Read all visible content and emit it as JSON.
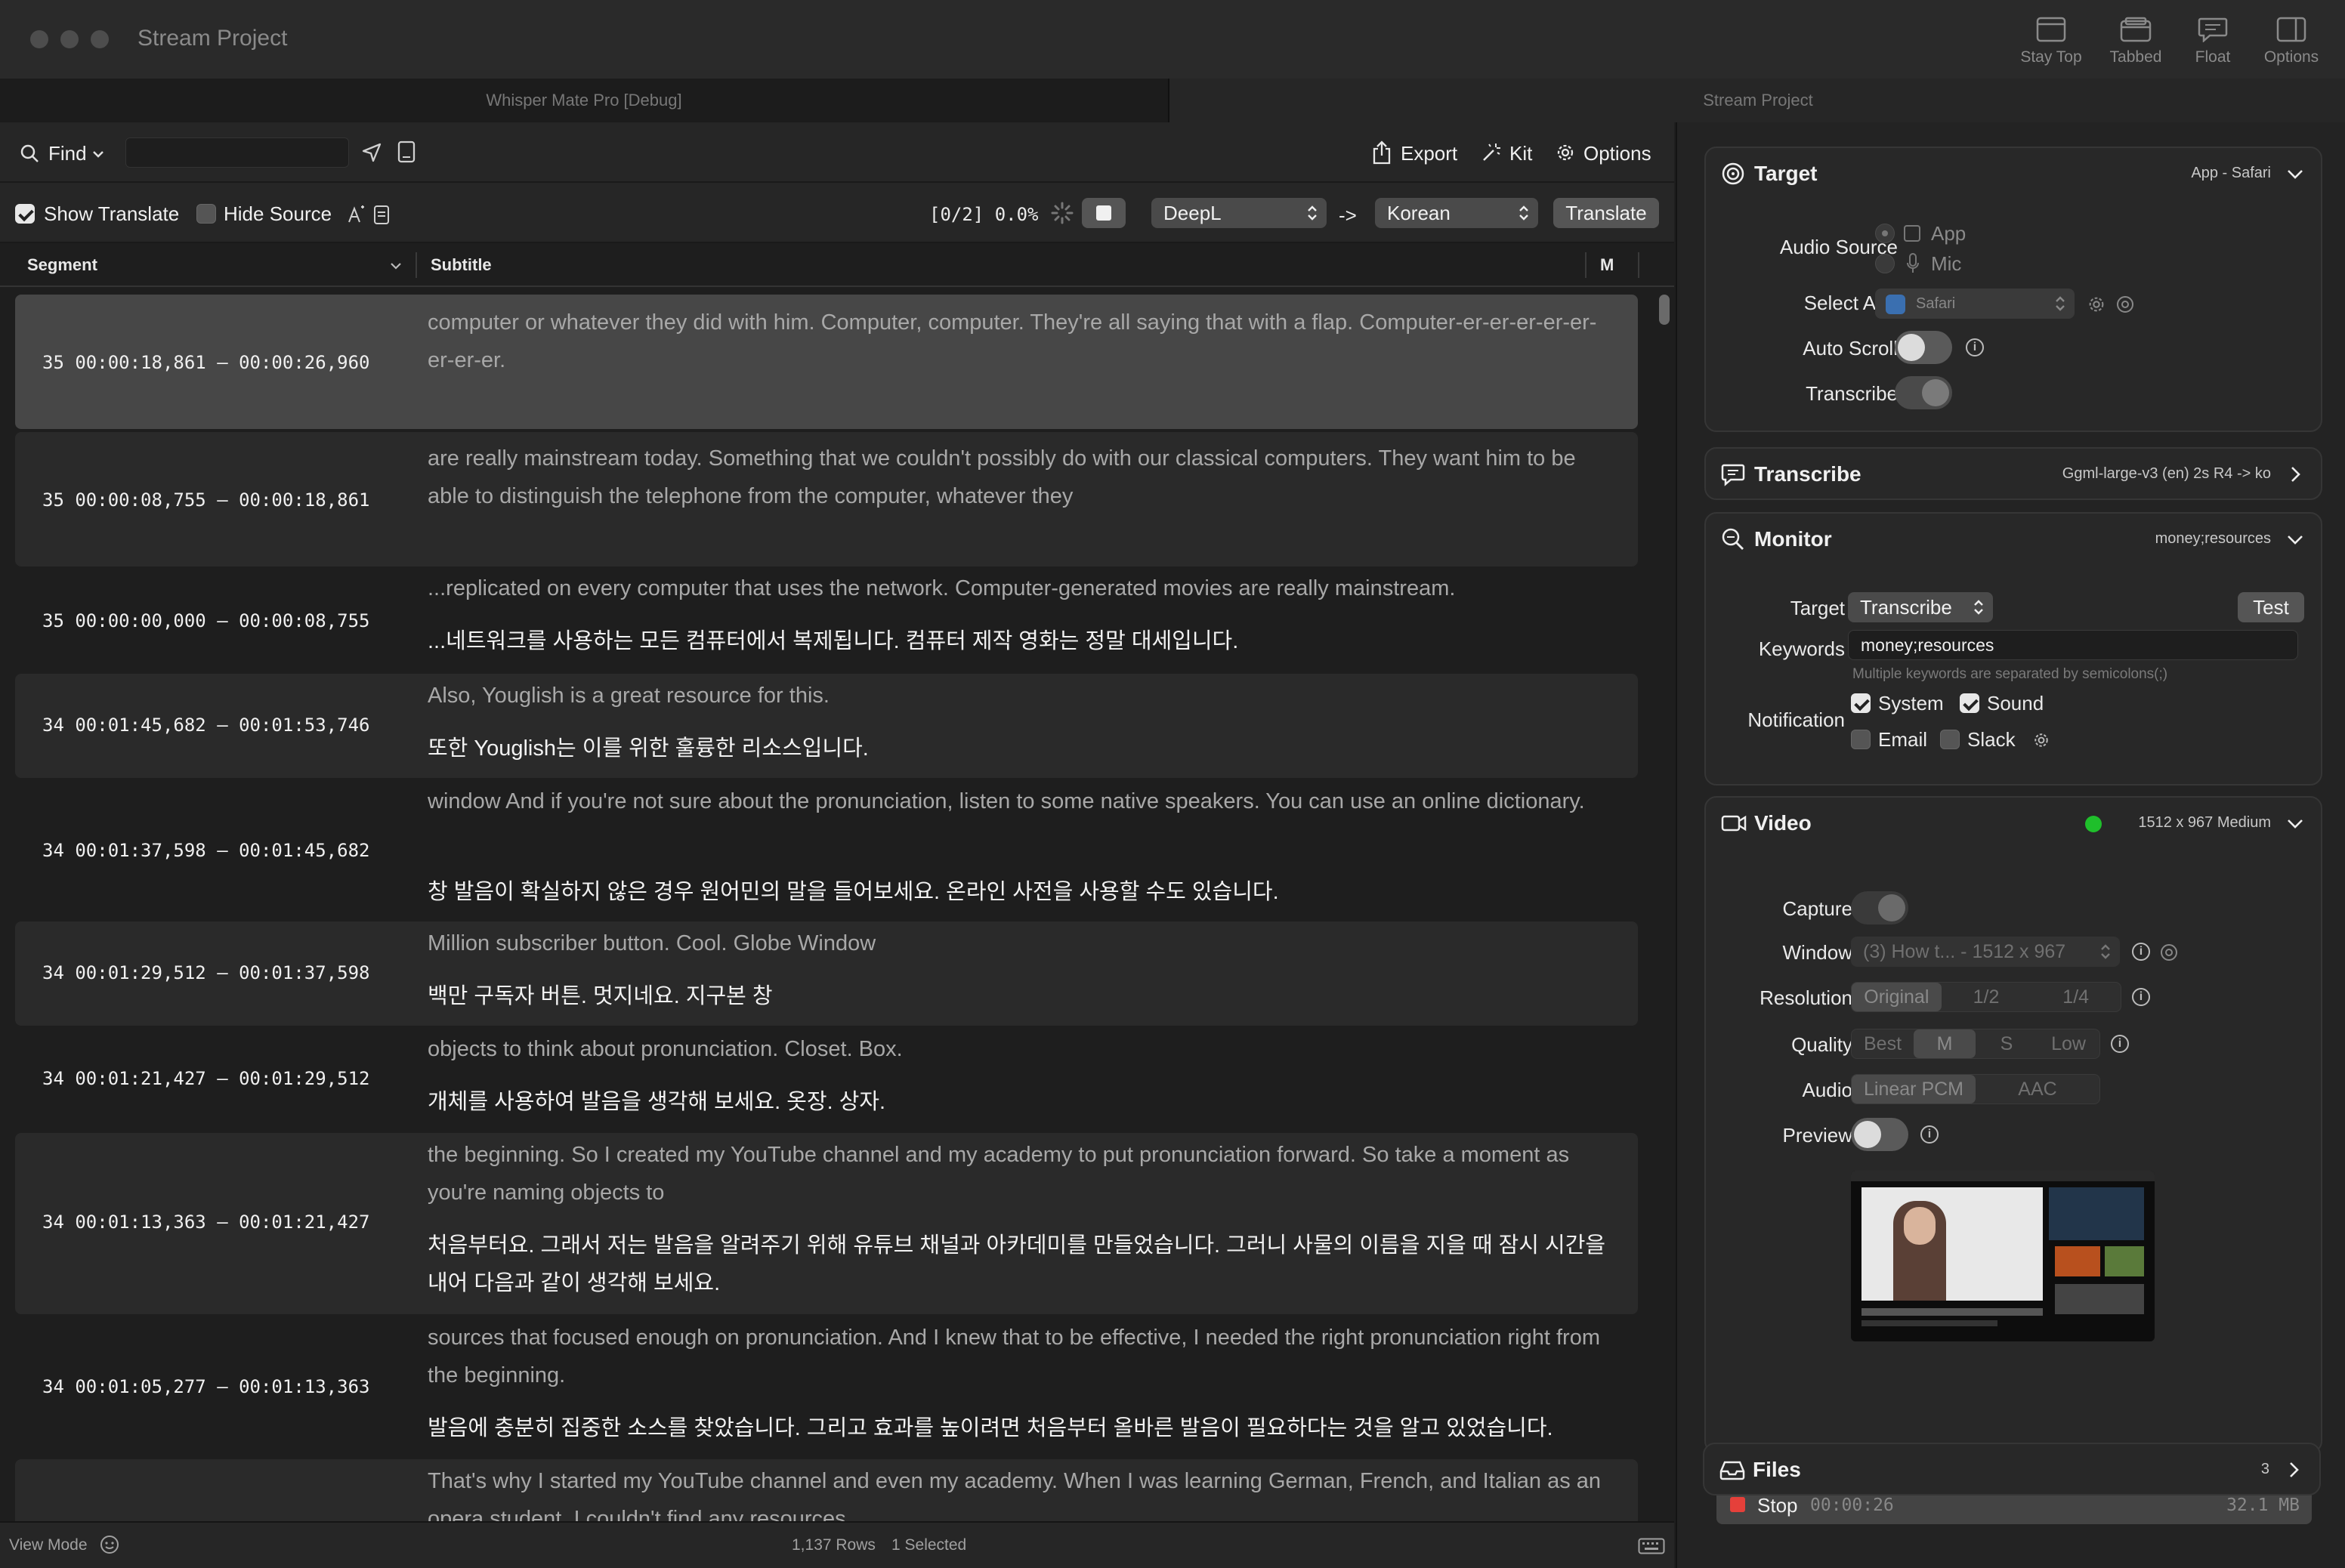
{
  "window": {
    "title": "Stream Project",
    "buttons": [
      {
        "label": "Stay Top",
        "icon": "window-icon"
      },
      {
        "label": "Tabbed",
        "icon": "tabbed-window-icon"
      },
      {
        "label": "Float",
        "icon": "speech-bubble-icon"
      },
      {
        "label": "Options",
        "icon": "sidebar-icon"
      }
    ]
  },
  "tabs": [
    "Whisper Mate Pro [Debug]",
    "Stream Project"
  ],
  "toolbar": {
    "find_label": "Find",
    "find_value": "",
    "export_label": "Export",
    "kit_label": "Kit",
    "options_label": "Options"
  },
  "toolbar2": {
    "show_translate": "Show Translate",
    "hide_source": "Hide Source",
    "progress": "[0/2] 0.0%",
    "engine": "DeepL",
    "arrow": "->",
    "language": "Korean",
    "translate": "Translate"
  },
  "columns": {
    "segment": "Segment",
    "subtitle": "Subtitle",
    "m": "M"
  },
  "rows": [
    {
      "seg": "35 00:00:18,861 – 00:00:26,960",
      "src": "computer or whatever they did with him. Computer, computer. They're all saying that with a flap. Computer-er-er-er-er-er-er-er-er.",
      "tr": ""
    },
    {
      "seg": "35 00:00:08,755 – 00:00:18,861",
      "src": "are really mainstream today. Something that we couldn't possibly do with our classical computers. They want him to be able to distinguish the telephone from the computer, whatever they",
      "tr": ""
    },
    {
      "seg": "35 00:00:00,000 – 00:00:08,755",
      "src": "...replicated on every computer that uses the network. Computer-generated movies are really mainstream.",
      "tr": "...네트워크를 사용하는 모든 컴퓨터에서 복제됩니다. 컴퓨터 제작 영화는 정말 대세입니다."
    },
    {
      "seg": "34 00:01:45,682 – 00:01:53,746",
      "src": "Also, Youglish is a great resource for this.",
      "tr": "또한 Youglish는 이를 위한 훌륭한 리소스입니다."
    },
    {
      "seg": "34 00:01:37,598 – 00:01:45,682",
      "src": "window And if you're not sure about the pronunciation, listen to some native speakers. You can use an online dictionary.",
      "tr": "창 발음이 확실하지 않은 경우 원어민의 말을 들어보세요. 온라인 사전을 사용할 수도 있습니다."
    },
    {
      "seg": "34 00:01:29,512 – 00:01:37,598",
      "src": "Million subscriber button. Cool. Globe Window",
      "tr": "백만 구독자 버튼. 멋지네요. 지구본 창"
    },
    {
      "seg": "34 00:01:21,427 – 00:01:29,512",
      "src": "objects to think about pronunciation. Closet. Box.",
      "tr": "개체를 사용하여 발음을 생각해 보세요. 옷장. 상자."
    },
    {
      "seg": "34 00:01:13,363 – 00:01:21,427",
      "src": "the beginning. So I created my YouTube channel and my academy to put pronunciation forward. So take a moment as you're naming objects to",
      "tr": "처음부터요. 그래서 저는 발음을 알려주기 위해 유튜브 채널과 아카데미를 만들었습니다. 그러니 사물의 이름을 지을 때 잠시 시간을 내어 다음과 같이 생각해 보세요."
    },
    {
      "seg": "34 00:01:05,277 – 00:01:13,363",
      "src": "sources that focused enough on pronunciation. And I knew that to be effective, I needed the right pronunciation right from the beginning.",
      "tr": "발음에 충분히 집중한 소스를 찾았습니다. 그리고 효과를 높이려면 처음부터 올바른 발음이 필요하다는 것을 알고 있었습니다."
    },
    {
      "seg": "",
      "src": "That's why I started my YouTube channel and even my academy. When I was learning German, French, and Italian as an opera student, I couldn't find any resources",
      "tr": ""
    }
  ],
  "status": {
    "view_mode": "View Mode",
    "rows": "1,137 Rows",
    "selected": "1 Selected"
  },
  "target": {
    "title": "Target",
    "meta": "App - Safari",
    "audio_source_label": "Audio Source",
    "opt_app": "App",
    "opt_mic": "Mic",
    "select_app_label": "Select App",
    "select_app_value": "Safari",
    "auto_scroll_label": "Auto Scroll",
    "auto_scroll_on": true,
    "transcribe_label": "Transcribe",
    "transcribe_on": false
  },
  "transcribe": {
    "title": "Transcribe",
    "meta": "Ggml-large-v3 (en) 2s R4 -> ko"
  },
  "monitor": {
    "title": "Monitor",
    "meta": "money;resources",
    "target_label": "Target",
    "target_value": "Transcribe",
    "test_label": "Test",
    "keywords_label": "Keywords",
    "keywords_value": "money;resources",
    "keywords_hint": "Multiple keywords are separated by semicolons(;)",
    "notification_label": "Notification",
    "system": "System",
    "sound": "Sound",
    "email": "Email",
    "slack": "Slack"
  },
  "video": {
    "title": "Video",
    "meta": "1512 x 967 Medium",
    "status_color": "#1fbf2b",
    "capture_label": "Capture",
    "window_label": "Window",
    "window_value": "(3) How t... - 1512 x 967",
    "resolution_label": "Resolution",
    "resolution_options": [
      "Original",
      "1/2",
      "1/4"
    ],
    "quality_label": "Quality",
    "quality_options": [
      "Best",
      "M",
      "S",
      "Low"
    ],
    "audio_label": "Audio",
    "audio_options": [
      "Linear PCM",
      "AAC"
    ],
    "preview_label": "Preview",
    "preview_on": true
  },
  "stop": {
    "label": "Stop",
    "time": "00:00:26",
    "size": "32.1 MB",
    "color": "#e5403a"
  },
  "files": {
    "title": "Files",
    "count": "3"
  }
}
